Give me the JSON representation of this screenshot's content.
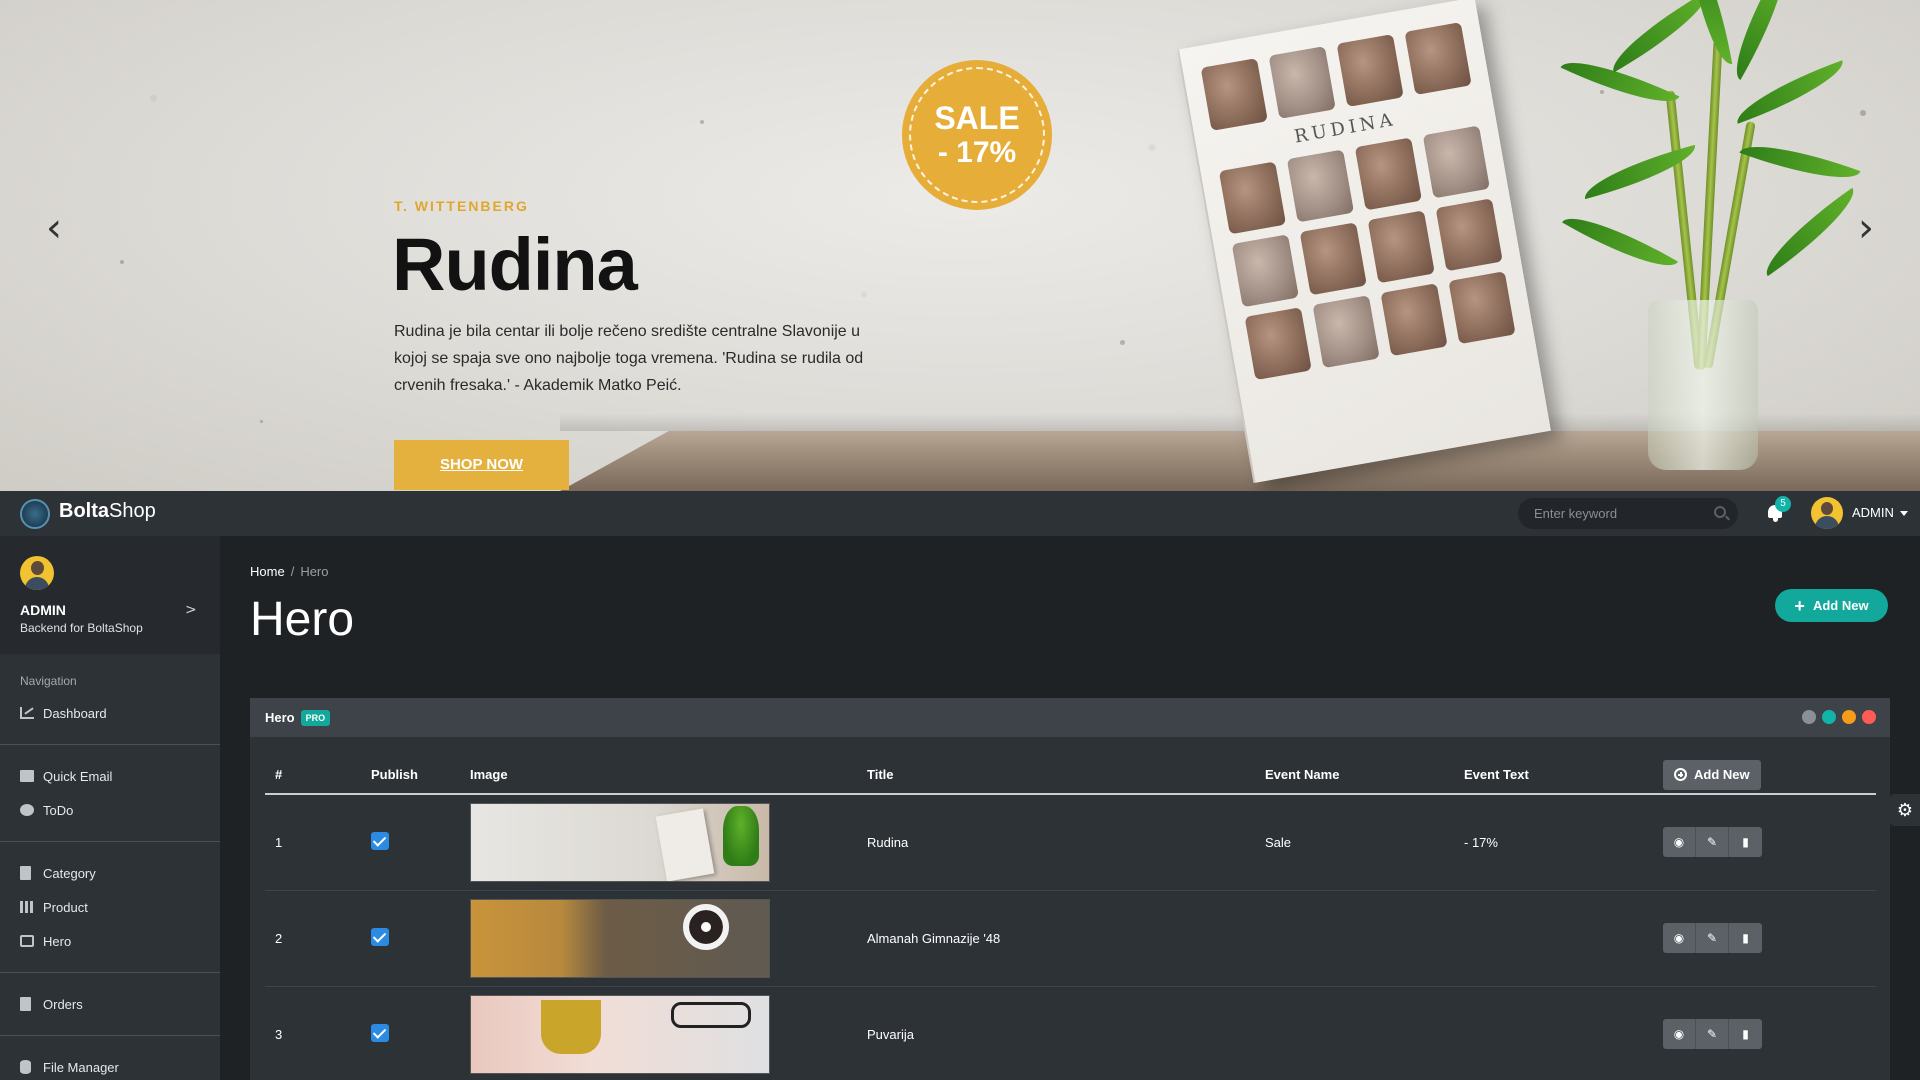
{
  "hero": {
    "author": "T. WITTENBERG",
    "title": "Rudina",
    "text": "Rudina je bila centar ili bolje rečeno središte centralne Slavonije u kojoj se spaja sve ono najbolje toga vremena. 'Rudina se rudila od crvenih fresaka.' - Akademik Matko Peić.",
    "shop_label": "SHOP NOW",
    "sale_line1": "SALE",
    "sale_line2": "- 17%",
    "book_cover_title": "RUDINA",
    "prev_glyph": "‹",
    "next_glyph": "›"
  },
  "topbar": {
    "brand_bold": "Bolta",
    "brand_rest": "Shop",
    "search_placeholder": "Enter keyword",
    "notification_count": "5",
    "user_label": "ADMIN"
  },
  "sidebar": {
    "profile_name": "ADMIN",
    "profile_sub": "Backend for BoltaShop",
    "nav_heading": "Navigation",
    "items": [
      {
        "label": "Dashboard",
        "icon": "chart-line-icon"
      },
      {
        "label": "Quick Email",
        "icon": "envelope-icon"
      },
      {
        "label": "ToDo",
        "icon": "check-circle-icon"
      },
      {
        "label": "Category",
        "icon": "file-icon"
      },
      {
        "label": "Product",
        "icon": "barcode-icon"
      },
      {
        "label": "Hero",
        "icon": "cast-icon"
      },
      {
        "label": "Orders",
        "icon": "file-icon"
      },
      {
        "label": "File Manager",
        "icon": "database-icon"
      }
    ]
  },
  "content": {
    "breadcrumb_home": "Home",
    "breadcrumb_sep": "/",
    "breadcrumb_current": "Hero",
    "page_title": "Hero",
    "add_new_label": "Add New"
  },
  "panel": {
    "title": "Hero",
    "badge": "PRO",
    "columns": [
      "#",
      "Publish",
      "Image",
      "Title",
      "Event Name",
      "Event Text"
    ],
    "add_label": "Add New",
    "rows": [
      {
        "num": "1",
        "title": "Rudina",
        "event_name": "Sale",
        "event_text": "- 17%",
        "published": true
      },
      {
        "num": "2",
        "title": "Almanah Gimnazije '48",
        "event_name": "",
        "event_text": "",
        "published": true
      },
      {
        "num": "3",
        "title": "Puvarija",
        "event_name": "",
        "event_text": "",
        "published": true
      }
    ]
  },
  "colors": {
    "accent_teal": "#12a89b",
    "gold": "#e5b13e",
    "checkbox_blue": "#2b8ae2"
  }
}
